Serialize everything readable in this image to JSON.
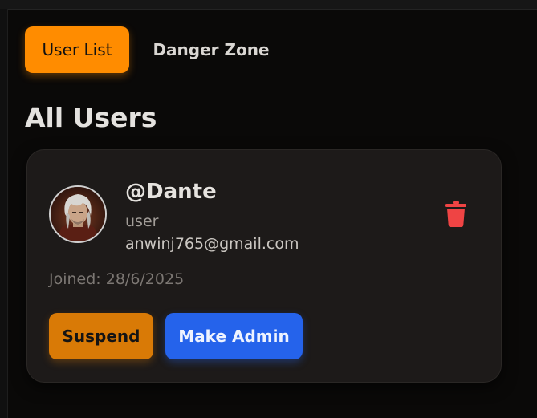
{
  "tabs": [
    {
      "label": "User List",
      "active": true
    },
    {
      "label": "Danger Zone",
      "active": false
    }
  ],
  "page": {
    "title": "All Users"
  },
  "users": [
    {
      "username": "@Dante",
      "role": "user",
      "email": "anwinj765@gmail.com",
      "joined": "Joined: 28/6/2025",
      "avatar_icon": "user-avatar-photo",
      "delete_icon": "trash-icon",
      "actions": {
        "suspend_label": "Suspend",
        "make_admin_label": "Make Admin"
      }
    }
  ],
  "colors": {
    "accent": "#ff8c00",
    "suspend": "#d97a06",
    "admin": "#2563eb",
    "danger": "#ef4444",
    "card": "#1d1a19",
    "background": "#0a0908"
  }
}
